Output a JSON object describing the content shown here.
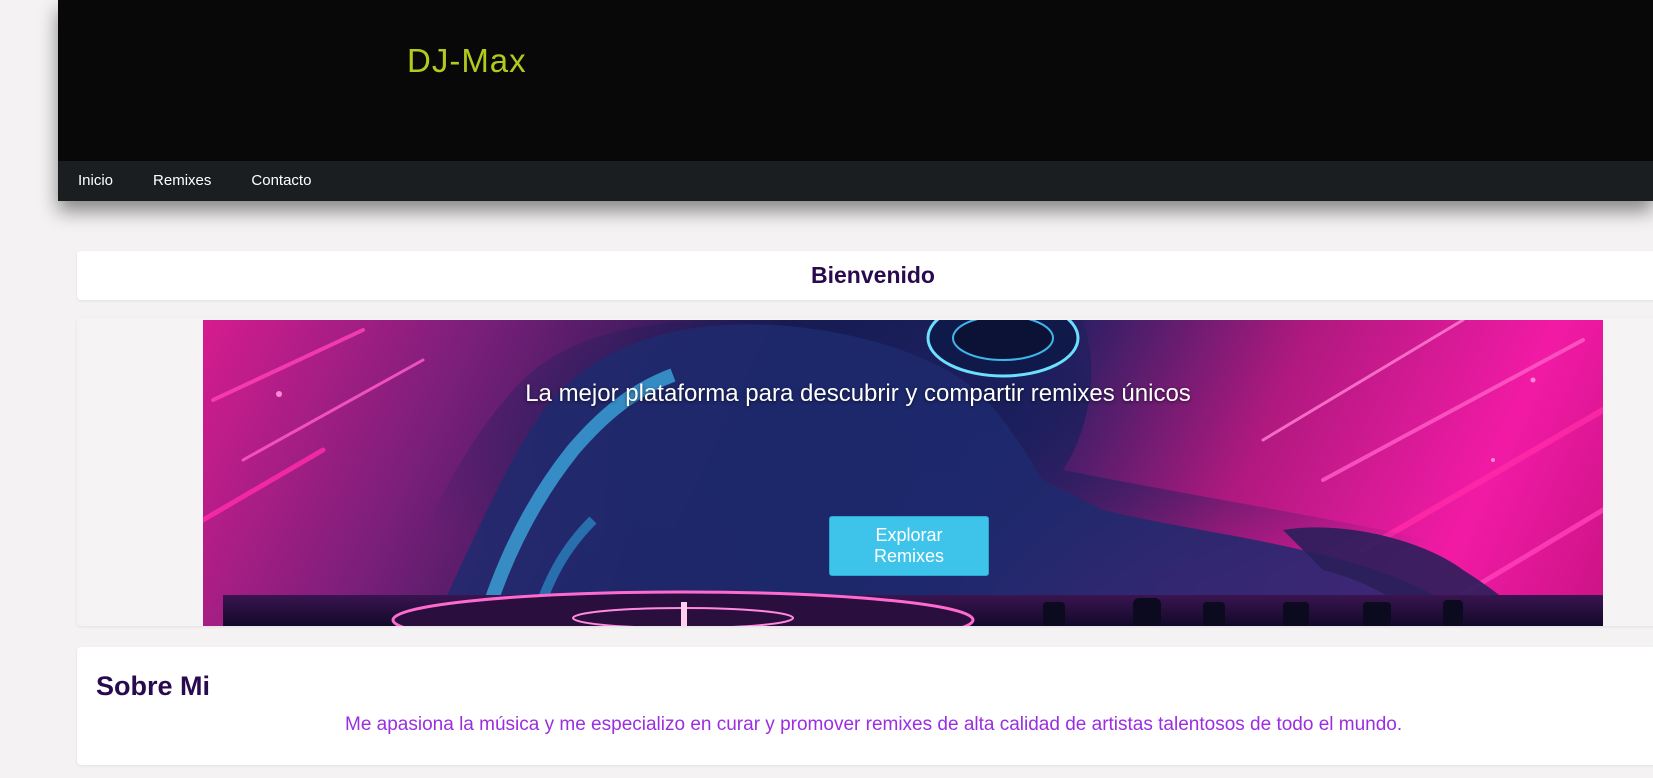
{
  "header": {
    "brand": "DJ-Max",
    "nav": [
      {
        "label": "Inicio"
      },
      {
        "label": "Remixes"
      },
      {
        "label": "Contacto"
      }
    ]
  },
  "welcome": {
    "title": "Bienvenido"
  },
  "hero": {
    "tagline": "La mejor plataforma para descubrir y compartir remixes únicos",
    "button_label": "Explorar Remixes"
  },
  "about": {
    "title": "Sobre Mi",
    "text": "Me apasiona la música y me especializo en curar y promover remixes de alta calidad de artistas talentosos de todo el mundo."
  },
  "colors": {
    "brand": "#b3c91d",
    "header_bg": "#080808",
    "nav_bg": "#1b1e20",
    "heading": "#2a0a4e",
    "accent_text": "#9b2ee0",
    "button": "#3ec4ea"
  }
}
